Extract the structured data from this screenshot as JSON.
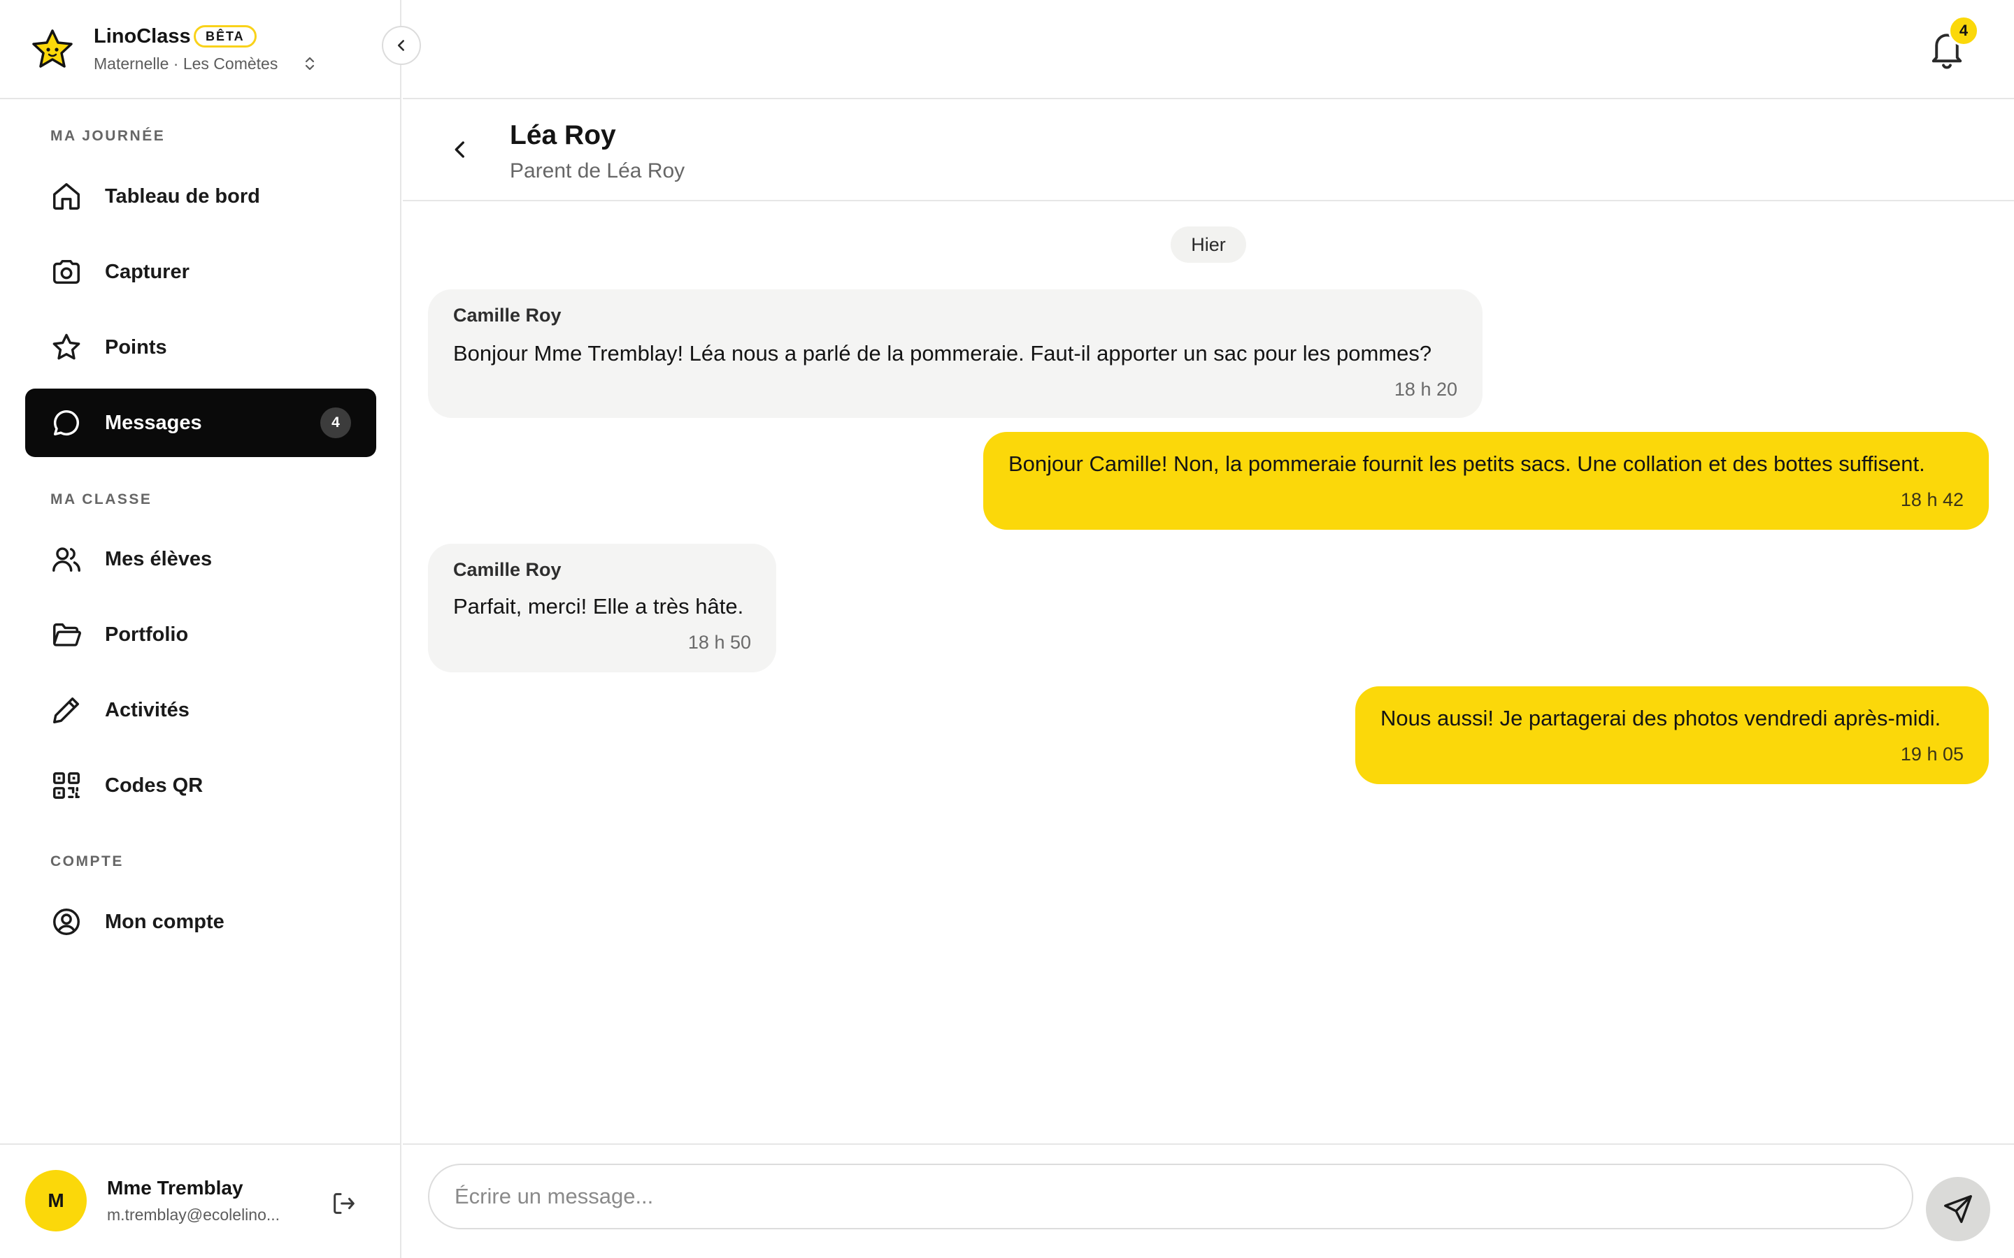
{
  "brand": {
    "name": "LinoClass",
    "badge": "BÊTA",
    "class_selector": "Maternelle · Les Comètes"
  },
  "colors": {
    "accent": "#fbd80a",
    "active_nav": "#0a0a0a",
    "bubble_in": "#f4f4f3"
  },
  "sidebar": {
    "sections": [
      {
        "label": "MA JOURNÉE"
      },
      {
        "label": "MA CLASSE"
      },
      {
        "label": "COMPTE"
      }
    ],
    "items": [
      {
        "label": "Tableau de bord",
        "icon": "home-icon"
      },
      {
        "label": "Capturer",
        "icon": "camera-icon"
      },
      {
        "label": "Points",
        "icon": "star-icon"
      },
      {
        "label": "Messages",
        "icon": "message-icon",
        "active": true,
        "badge": "4"
      },
      {
        "label": "Mes élèves",
        "icon": "users-icon"
      },
      {
        "label": "Portfolio",
        "icon": "folder-icon"
      },
      {
        "label": "Activités",
        "icon": "pencil-icon"
      },
      {
        "label": "Codes QR",
        "icon": "qr-code-icon"
      },
      {
        "label": "Mon compte",
        "icon": "user-circle-icon"
      }
    ]
  },
  "user": {
    "initial": "M",
    "name": "Mme Tremblay",
    "email": "m.tremblay@ecolelino..."
  },
  "topbar": {
    "notifications_count": "4"
  },
  "conversation": {
    "title": "Léa Roy",
    "subtitle": "Parent de Léa Roy",
    "day_label": "Hier",
    "messages": [
      {
        "direction": "in",
        "sender": "Camille Roy",
        "text": "Bonjour Mme Tremblay! Léa nous a parlé de la pommeraie. Faut-il apporter un sac pour les pommes?",
        "time": "18 h 20"
      },
      {
        "direction": "out",
        "text": "Bonjour Camille! Non, la pommeraie fournit les petits sacs. Une collation et des bottes suffisent.",
        "time": "18 h 42"
      },
      {
        "direction": "in",
        "sender": "Camille Roy",
        "text": "Parfait, merci! Elle a très hâte.",
        "time": "18 h 50"
      },
      {
        "direction": "out",
        "text": "Nous aussi! Je partagerai des photos vendredi après-midi.",
        "time": "19 h 05"
      }
    ]
  },
  "composer": {
    "placeholder": "Écrire un message...",
    "value": ""
  }
}
